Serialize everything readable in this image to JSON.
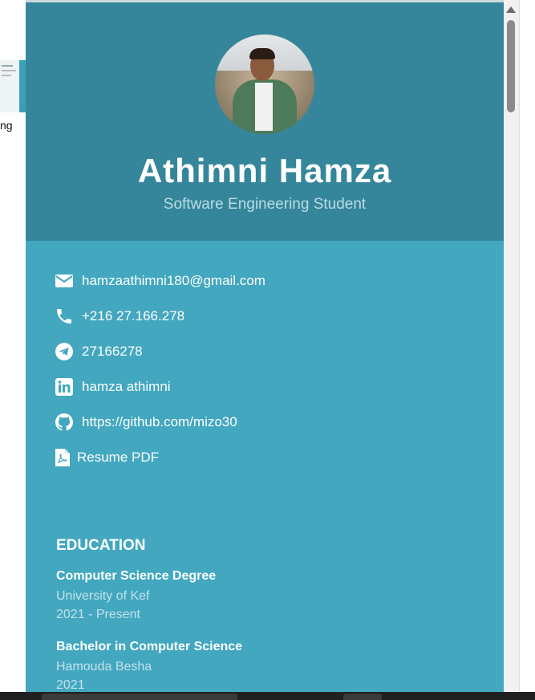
{
  "left_window": {
    "partial_text": "ng"
  },
  "profile": {
    "name": "Athimni Hamza",
    "title": "Software Engineering Student"
  },
  "contacts": [
    {
      "icon": "envelope-icon",
      "text": "hamzaathimni180@gmail.com"
    },
    {
      "icon": "phone-icon",
      "text": "+216 27.166.278"
    },
    {
      "icon": "telegram-icon",
      "text": "27166278"
    },
    {
      "icon": "linkedin-icon",
      "text": "hamza athimni"
    },
    {
      "icon": "github-icon",
      "text": "https://github.com/mizo30"
    },
    {
      "icon": "pdf-file-icon",
      "text": "Resume PDF"
    }
  ],
  "education": {
    "title": "EDUCATION",
    "items": [
      {
        "degree": "Computer Science Degree",
        "school": "University of Kef",
        "year": "2021 - Present"
      },
      {
        "degree": "Bachelor in Computer Science",
        "school": "Hamouda Besha",
        "year": "2021"
      }
    ]
  },
  "colors": {
    "header_bg": "#35869a",
    "body_bg": "#42a7bf",
    "text": "#ffffff",
    "muted_text": "#c4e2ea"
  }
}
